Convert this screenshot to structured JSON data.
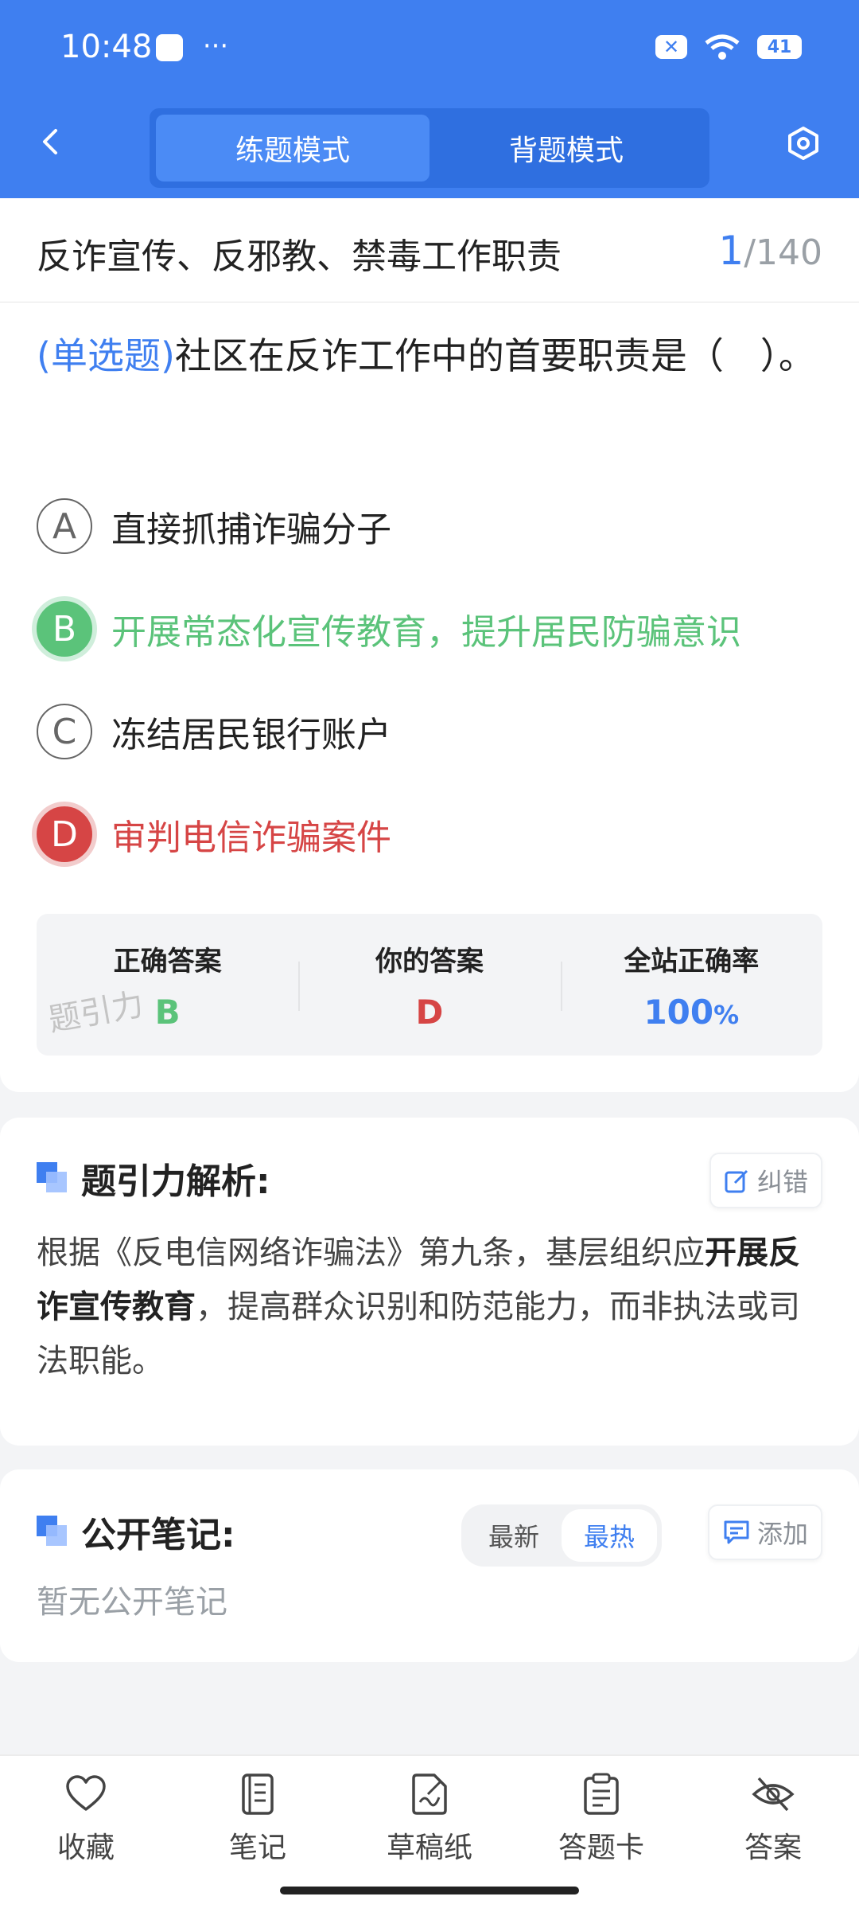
{
  "status_bar": {
    "time": "10:48",
    "dots": "···",
    "battery": "41"
  },
  "header": {
    "modes": [
      "练题模式",
      "背题模式"
    ],
    "active_mode": 0
  },
  "chapter": {
    "title": "反诈宣传、反邪教、禁毒工作职责",
    "current": "1",
    "total": "/140"
  },
  "question": {
    "type_label": "(单选题)",
    "text": "社区在反诈工作中的首要职责是（　）。",
    "options": [
      {
        "letter": "A",
        "text": "直接抓捕诈骗分子",
        "state": "normal"
      },
      {
        "letter": "B",
        "text": "开展常态化宣传教育，提升居民防骗意识",
        "state": "correct"
      },
      {
        "letter": "C",
        "text": "冻结居民银行账户",
        "state": "normal"
      },
      {
        "letter": "D",
        "text": "审判电信诈骗案件",
        "state": "wrong"
      }
    ]
  },
  "result": {
    "correct_label": "正确答案",
    "correct_value": "B",
    "yours_label": "你的答案",
    "yours_value": "D",
    "rate_label": "全站正确率",
    "rate_value": "100",
    "rate_unit": "%",
    "watermark": "题引力"
  },
  "analysis": {
    "title": "题引力解析:",
    "report_label": "纠错",
    "text_before": "根据《反电信网络诈骗法》第九条，基层组织应",
    "text_bold": "开展反诈宣传教育",
    "text_after": "，提高群众识别和防范能力，而非执法或司法职能。"
  },
  "notes": {
    "title": "公开笔记:",
    "sort_latest": "最新",
    "sort_hot": "最热",
    "add_label": "添加",
    "empty": "暂无公开笔记"
  },
  "bottom_tabs": [
    {
      "label": "收藏",
      "icon": "heart-icon"
    },
    {
      "label": "笔记",
      "icon": "notebook-icon"
    },
    {
      "label": "草稿纸",
      "icon": "draft-paper-icon"
    },
    {
      "label": "答题卡",
      "icon": "answer-sheet-icon"
    },
    {
      "label": "答案",
      "icon": "eye-off-icon"
    }
  ],
  "colors": {
    "primary": "#3f7ff0",
    "correct": "#5bc37a",
    "wrong": "#d64545"
  }
}
